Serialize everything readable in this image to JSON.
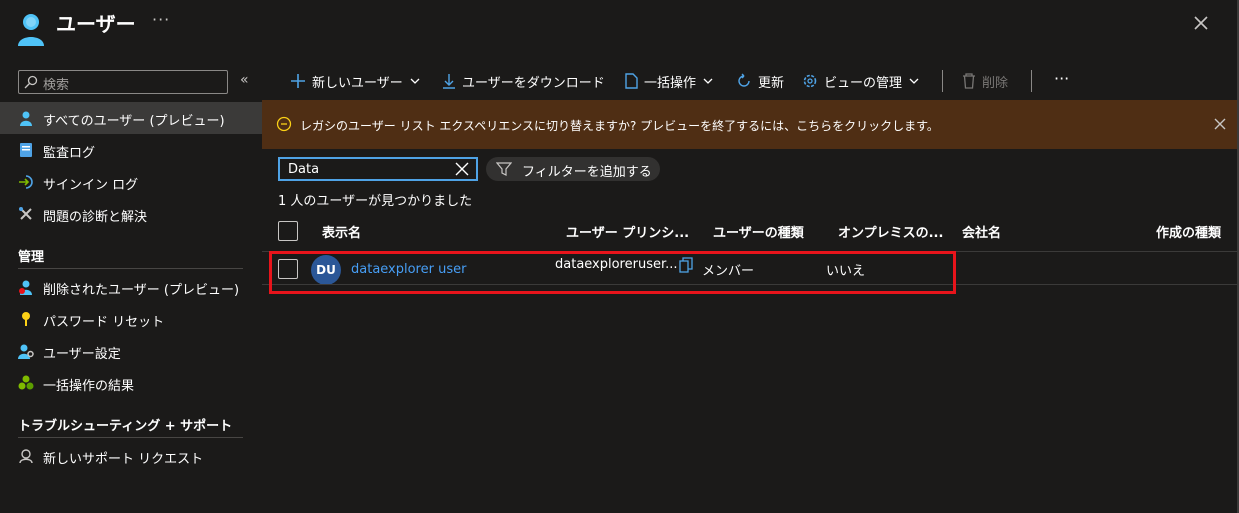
{
  "header": {
    "title": "ユーザー",
    "more": "···"
  },
  "sidebar": {
    "search_placeholder": "検索",
    "collapse": "«",
    "items": [
      {
        "label": "すべてのユーザー (プレビュー)",
        "icon": "user-icon",
        "active": true
      },
      {
        "label": "監査ログ",
        "icon": "audit-log-icon"
      },
      {
        "label": "サインイン ログ",
        "icon": "sign-in-icon"
      },
      {
        "label": "問題の診断と解決",
        "icon": "wrench-icon"
      }
    ],
    "section_manage": "管理",
    "manage_items": [
      {
        "label": "削除されたユーザー (プレビュー)",
        "icon": "deleted-user-icon"
      },
      {
        "label": "パスワード リセット",
        "icon": "key-icon"
      },
      {
        "label": "ユーザー設定",
        "icon": "user-settings-icon"
      },
      {
        "label": "一括操作の結果",
        "icon": "bulk-results-icon"
      }
    ],
    "section_support": "トラブルシューティング + サポート",
    "support_items": [
      {
        "label": "新しいサポート リクエスト",
        "icon": "support-icon"
      }
    ]
  },
  "toolbar": {
    "new_user": "新しいユーザー",
    "download": "ユーザーをダウンロード",
    "bulk": "一括操作",
    "refresh": "更新",
    "manage_view": "ビューの管理",
    "delete": "削除",
    "more": "···"
  },
  "banner": {
    "text": "レガシのユーザー リスト エクスペリエンスに切り替えますか? プレビューを終了するには、こちらをクリックします。"
  },
  "filter": {
    "value": "Data",
    "add_filter": "フィルターを追加する",
    "result_count": "1 人のユーザーが見つかりました"
  },
  "table": {
    "columns": [
      "表示名",
      "ユーザー プリンシ...",
      "ユーザーの種類",
      "オンプレミスの...",
      "会社名",
      "作成の種類"
    ],
    "rows": [
      {
        "initials": "DU",
        "display_name": "dataexplorer user",
        "upn": "dataexploreruser...",
        "user_type": "メンバー",
        "on_prem": "いいえ",
        "company": "",
        "creation_type": ""
      }
    ]
  },
  "colors": {
    "background": "#1b1a19",
    "banner": "#4f2e14",
    "accent": "#479ef5",
    "highlight": "#e8141b",
    "avatar": "#2b5797"
  }
}
